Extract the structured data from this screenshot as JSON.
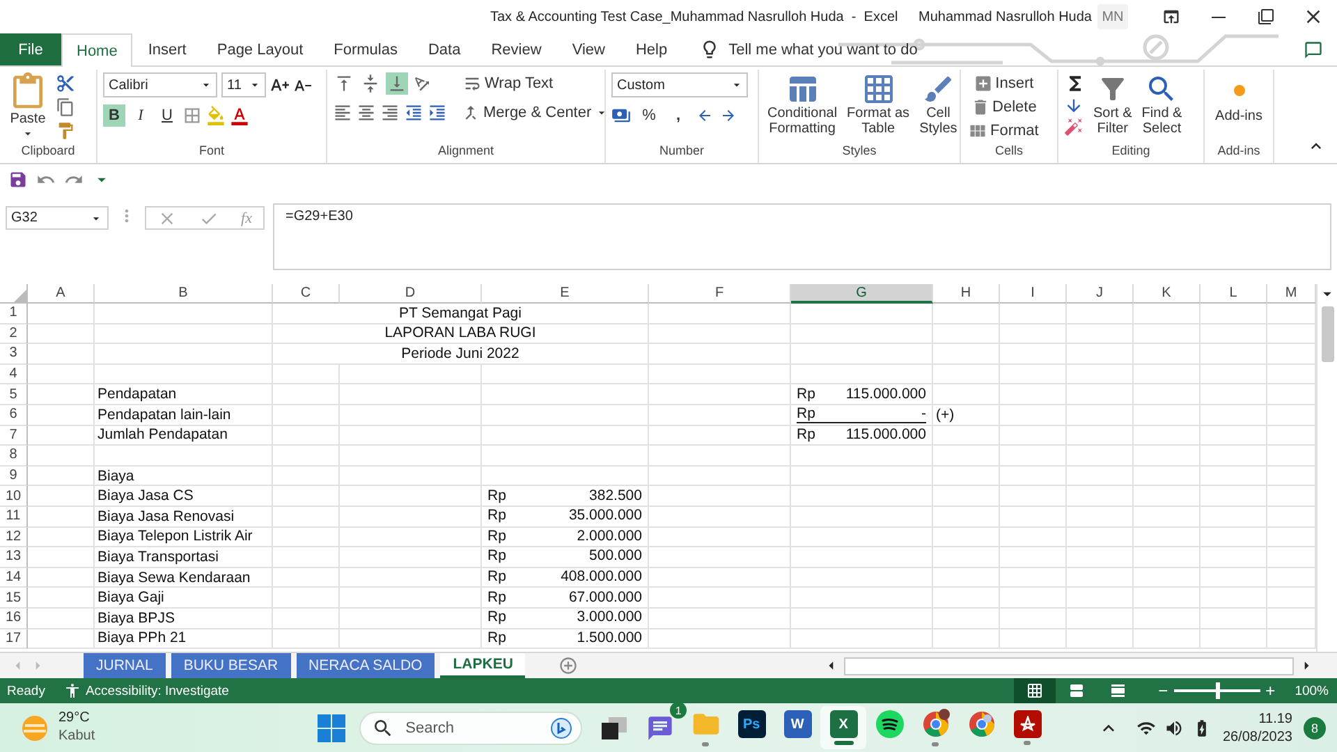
{
  "title_bar": {
    "document_title": "Tax & Accounting Test Case_Muhammad Nasrulloh Huda  -  Excel",
    "user_name": "Muhammad Nasrulloh Huda",
    "user_initials": "MN"
  },
  "ribbon_tabs": [
    {
      "label": "File",
      "kind": "file",
      "selected": false
    },
    {
      "label": "Home",
      "kind": "tab",
      "selected": true
    },
    {
      "label": "Insert",
      "kind": "tab",
      "selected": false
    },
    {
      "label": "Page Layout",
      "kind": "tab",
      "selected": false
    },
    {
      "label": "Formulas",
      "kind": "tab",
      "selected": false
    },
    {
      "label": "Data",
      "kind": "tab",
      "selected": false
    },
    {
      "label": "Review",
      "kind": "tab",
      "selected": false
    },
    {
      "label": "View",
      "kind": "tab",
      "selected": false
    },
    {
      "label": "Help",
      "kind": "tab",
      "selected": false
    }
  ],
  "tell_me": {
    "placeholder": "Tell me what you want to do"
  },
  "ribbon": {
    "clipboard": {
      "label": "Clipboard",
      "paste": "Paste"
    },
    "font": {
      "label": "Font",
      "font_name": "Calibri",
      "font_size": "11",
      "styles": [
        {
          "text": "B",
          "kind": "bold",
          "selected": true
        },
        {
          "text": "I",
          "kind": "italic",
          "selected": false
        },
        {
          "text": "U",
          "kind": "underline",
          "selected": false
        }
      ]
    },
    "alignment": {
      "label": "Alignment",
      "vertical_align": [
        {
          "kind": "top",
          "selected": false
        },
        {
          "kind": "middle",
          "selected": false
        },
        {
          "kind": "bottom",
          "selected": true
        }
      ],
      "wrap_text": "Wrap Text",
      "merge_center": "Merge & Center"
    },
    "number": {
      "label": "Number",
      "format": "Custom",
      "percent": "%",
      "comma": ","
    },
    "styles": {
      "label": "Styles",
      "buttons": [
        {
          "kind": "conditional",
          "lines": [
            "Conditional",
            "Formatting"
          ]
        },
        {
          "kind": "table",
          "lines": [
            "Format as",
            "Table"
          ]
        },
        {
          "kind": "cell",
          "lines": [
            "Cell",
            "Styles"
          ]
        }
      ]
    },
    "cells": {
      "label": "Cells",
      "buttons": [
        {
          "kind": "insert",
          "text": "Insert"
        },
        {
          "kind": "delete",
          "text": "Delete"
        },
        {
          "kind": "format",
          "text": "Format"
        }
      ]
    },
    "editing": {
      "label": "Editing",
      "buttons": [
        {
          "kind": "sort",
          "lines": [
            "Sort &",
            "Filter"
          ]
        },
        {
          "kind": "find",
          "lines": [
            "Find &",
            "Select"
          ]
        }
      ]
    },
    "add_ins": {
      "label": "Add-ins",
      "button": "Add-ins"
    }
  },
  "formula_bar": {
    "name_box": "G32",
    "fx": "fx",
    "formula": "=G29+E30"
  },
  "columns": [
    {
      "label": "A",
      "selected": false
    },
    {
      "label": "B",
      "selected": false
    },
    {
      "label": "C",
      "selected": false
    },
    {
      "label": "D",
      "selected": false
    },
    {
      "label": "E",
      "selected": false
    },
    {
      "label": "F",
      "selected": false
    },
    {
      "label": "G",
      "selected": true
    },
    {
      "label": "H",
      "selected": false
    },
    {
      "label": "I",
      "selected": false
    },
    {
      "label": "J",
      "selected": false
    },
    {
      "label": "K",
      "selected": false
    },
    {
      "label": "L",
      "selected": false
    },
    {
      "label": "M",
      "selected": false
    }
  ],
  "rows": [
    {
      "number": "1",
      "title": "PT Semangat Pagi"
    },
    {
      "number": "2",
      "title": "LAPORAN LABA RUGI"
    },
    {
      "number": "3",
      "title": "Periode Juni 2022"
    },
    {
      "number": "4"
    },
    {
      "number": "5",
      "label": "Pendapatan",
      "col_g": {
        "currency": "Rp",
        "amount": "115.000.000",
        "underlined": false
      }
    },
    {
      "number": "6",
      "label": "Pendapatan lain-lain",
      "col_g": {
        "currency": "Rp",
        "amount": "-",
        "underlined": true
      },
      "col_h": "(+)"
    },
    {
      "number": "7",
      "label": "Jumlah Pendapatan",
      "col_g": {
        "currency": "Rp",
        "amount": "115.000.000",
        "underlined": false
      }
    },
    {
      "number": "8"
    },
    {
      "number": "9",
      "label": "Biaya"
    },
    {
      "number": "10",
      "label": "Biaya Jasa CS",
      "col_e": {
        "currency": "Rp",
        "amount": "382.500",
        "underlined": false
      }
    },
    {
      "number": "11",
      "label": "Biaya Jasa Renovasi",
      "col_e": {
        "currency": "Rp",
        "amount": "35.000.000",
        "underlined": false
      }
    },
    {
      "number": "12",
      "label": "Biaya Telepon Listrik Air",
      "col_e": {
        "currency": "Rp",
        "amount": "2.000.000",
        "underlined": false
      }
    },
    {
      "number": "13",
      "label": "Biaya Transportasi",
      "col_e": {
        "currency": "Rp",
        "amount": "500.000",
        "underlined": false
      }
    },
    {
      "number": "14",
      "label": "Biaya Sewa Kendaraan",
      "col_e": {
        "currency": "Rp",
        "amount": "408.000.000",
        "underlined": false
      }
    },
    {
      "number": "15",
      "label": "Biaya Gaji",
      "col_e": {
        "currency": "Rp",
        "amount": "67.000.000",
        "underlined": false
      }
    },
    {
      "number": "16",
      "label": "Biaya BPJS",
      "col_e": {
        "currency": "Rp",
        "amount": "3.000.000",
        "underlined": false
      }
    },
    {
      "number": "17",
      "label": "Biaya PPh 21",
      "col_e": {
        "currency": "Rp",
        "amount": "1.500.000",
        "underlined": false
      }
    }
  ],
  "sheet_tabs": [
    {
      "label": "JURNAL",
      "selected": false
    },
    {
      "label": "BUKU BESAR",
      "selected": false
    },
    {
      "label": "NERACA SALDO",
      "selected": false
    },
    {
      "label": "LAPKEU",
      "selected": true
    }
  ],
  "status_bar": {
    "ready": "Ready",
    "accessibility": "Accessibility: Investigate",
    "views": [
      {
        "kind": "normal",
        "selected": true
      },
      {
        "kind": "page_layout",
        "selected": false
      },
      {
        "kind": "page_break",
        "selected": false
      }
    ],
    "zoom_out": "−",
    "zoom_slider": {
      "level": 0.5
    },
    "zoom_in": "+",
    "zoom": "100%"
  },
  "taskbar": {
    "weather": {
      "temperature": "29°C",
      "condition": "Kabut"
    },
    "search": {
      "placeholder": "Search"
    },
    "chat_badge": "1",
    "apps": [
      {
        "kind": "explorer",
        "running": true,
        "selected": false
      },
      {
        "kind": "photoshop",
        "text": "Ps",
        "running": false,
        "selected": false
      },
      {
        "kind": "word",
        "text": "W",
        "running": false,
        "selected": false
      },
      {
        "kind": "excel",
        "text": "X",
        "running": true,
        "selected": true
      },
      {
        "kind": "spotify",
        "running": false,
        "selected": false
      },
      {
        "kind": "chrome_profile",
        "running": true,
        "selected": false
      },
      {
        "kind": "chrome",
        "running": false,
        "selected": false
      },
      {
        "kind": "acrobat",
        "running": true,
        "selected": false
      }
    ],
    "time": "11.19",
    "date": "26/08/2023",
    "notifications": "8"
  }
}
